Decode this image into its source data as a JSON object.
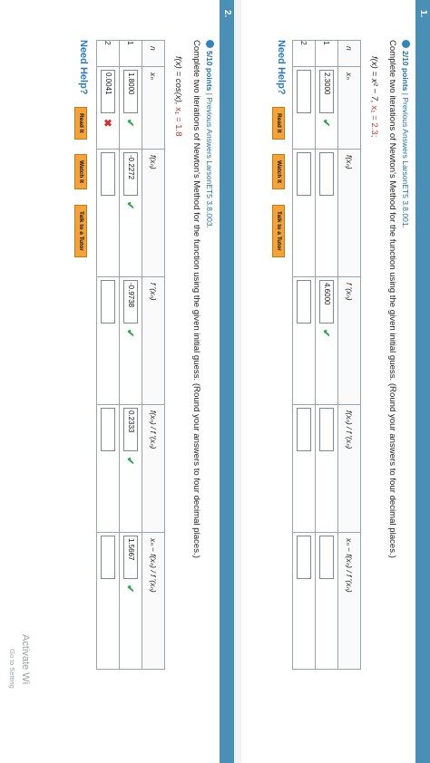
{
  "q1": {
    "number": "1.",
    "points": "2/10 points",
    "source": " | Previous Answers  LarsonET5 3.8.001.",
    "prompt": "Complete two iterations of Newton's Method for the function using the given initial guess. (Round your answers to four decimal places.)",
    "func": "f(x) = x² − 7,",
    "init": "x₁ = 2.3;",
    "headers": [
      "n",
      "xₙ",
      "f(xₙ)",
      "f ′(xₙ)",
      "f(xₙ) / f ′(xₙ)",
      "xₙ − f(xₙ) / f ′(xₙ)"
    ],
    "rows": [
      {
        "n": "1",
        "xn": "2.3000",
        "fxn": "",
        "dfxn": "4.6000",
        "ratio": "",
        "next": ""
      },
      {
        "n": "2",
        "xn": "",
        "fxn": "",
        "dfxn": "",
        "ratio": "",
        "next": ""
      }
    ],
    "need_help": "Need Help?",
    "read_it": "Read It",
    "watch_it": "Watch It",
    "tutor": "Talk to a Tutor"
  },
  "q2": {
    "number": "2.",
    "points": "5/10 points",
    "source": " | Previous Answers  LarsonET5 3.8.003.",
    "prompt": "Complete two iterations of Newton's Method for the function using the given initial guess. (Round your answers to four decimal places.)",
    "func": "f(x) = cos(x),",
    "init": "x₁ = 1.8",
    "headers": [
      "n",
      "xₙ",
      "f(xₙ)",
      "f ′(xₙ)",
      "f(xₙ) / f ′(xₙ)",
      "xₙ − f(xₙ) / f ′(xₙ)"
    ],
    "rows": [
      {
        "n": "1",
        "xn": "1.8000",
        "fxn": "-0.2272",
        "dfxn": "-0.9738",
        "ratio": "0.2333",
        "next": "1.5667"
      },
      {
        "n": "2",
        "xn": "0.0041",
        "fxn": "",
        "dfxn": "",
        "ratio": "",
        "next": ""
      }
    ],
    "need_help": "Need Help?",
    "read_it": "Read It",
    "watch_it": "Watch It",
    "tutor": "Talk to a Tutor"
  },
  "watermark": {
    "line1": "Activate Wi",
    "line2": "Go to Setting"
  },
  "colors": {
    "accent": "#2f86bd",
    "header_bar": "#4a8fb5",
    "correct": "#2ba84a",
    "incorrect": "#d42b2b",
    "help_button": "#f4a23a"
  }
}
